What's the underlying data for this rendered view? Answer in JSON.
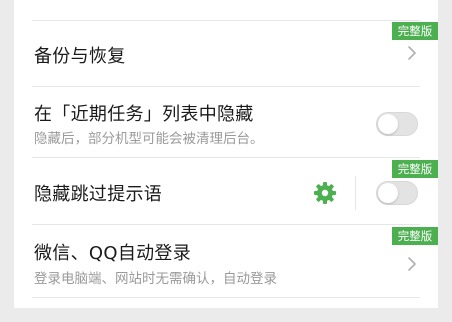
{
  "settings": {
    "items": [
      {
        "title": "备份与恢复",
        "badge": "完整版",
        "control": "chevron",
        "chevron_icon": "chevron-right-icon"
      },
      {
        "title": "在「近期任务」列表中隐藏",
        "subtitle": "隐藏后，部分机型可能会被清理后台。",
        "control": "toggle",
        "toggle_on": false
      },
      {
        "title": "隐藏跳过提示语",
        "badge": "完整版",
        "control": "toggle",
        "toggle_on": false,
        "settings_icon": "gear-icon"
      },
      {
        "title": "微信、QQ自动登录",
        "subtitle": "登录电脑端、网站时无需确认，自动登录",
        "badge": "完整版",
        "control": "chevron",
        "chevron_icon": "chevron-right-icon"
      }
    ]
  },
  "colors": {
    "badge_background": "#4caf50",
    "gear": "#4caf50",
    "toggle_off": "#e3e3e3",
    "page_background": "#ebebeb"
  }
}
